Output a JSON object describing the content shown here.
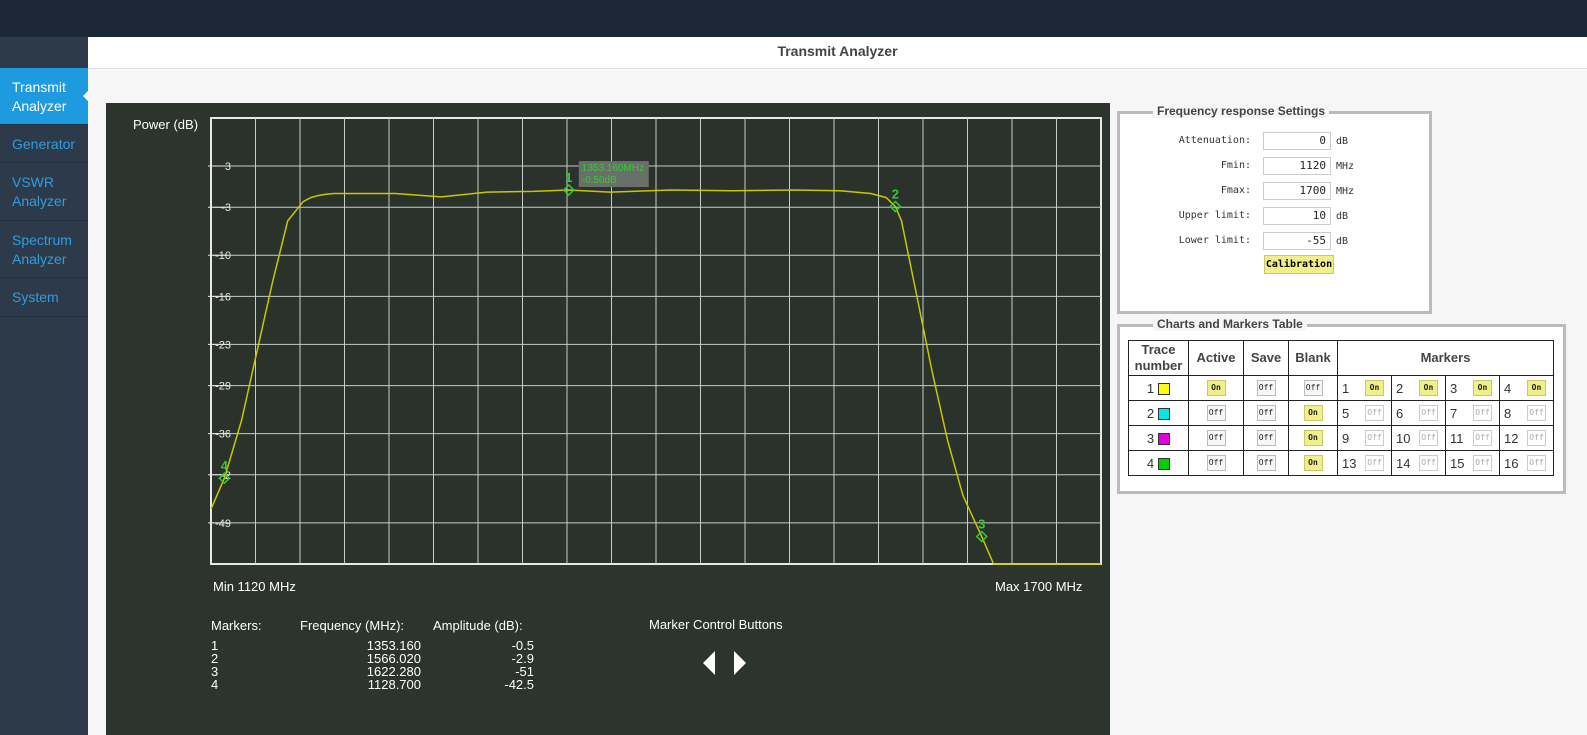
{
  "app": {
    "title": "Transmit Analyzer"
  },
  "sidebar": {
    "items": [
      {
        "label_1": "Transmit",
        "label_2": "Analyzer",
        "active": true
      },
      {
        "label_1": "Generator",
        "label_2": "",
        "active": false
      },
      {
        "label_1": "VSWR",
        "label_2": "Analyzer",
        "active": false
      },
      {
        "label_1": "Spectrum",
        "label_2": "Analyzer",
        "active": false
      },
      {
        "label_1": "System",
        "label_2": "",
        "active": false
      }
    ]
  },
  "chart": {
    "ylabel": "Power (dB)",
    "min_label": "Min 1120 MHz",
    "max_label": "Max 1700 MHz"
  },
  "chart_data": {
    "type": "line",
    "ylabel": "Power (dB)",
    "xlim": [
      1120,
      1700
    ],
    "ylim": [
      -55,
      10
    ],
    "y_ticks": [
      3,
      -3,
      -10,
      -16,
      -23,
      -29,
      -36,
      -42,
      -49
    ],
    "y_tick_labels": [
      "3",
      "-3",
      "-10",
      "-16",
      "-23",
      "-29",
      "-36",
      "-2",
      "-49"
    ],
    "grid": true,
    "series": [
      {
        "color": "#c8c800",
        "x": [
          1120,
          1128.7,
          1140,
          1150,
          1160,
          1170,
          1180,
          1185,
          1190,
          1195,
          1200,
          1210,
          1240,
          1270,
          1300,
          1330,
          1353.16,
          1380,
          1420,
          1460,
          1500,
          1530,
          1550,
          1560,
          1566.02,
          1570,
          1580,
          1590,
          1600,
          1610,
          1622.28,
          1630,
          1640,
          1700
        ],
        "y": [
          -47,
          -42.5,
          -34,
          -24,
          -14,
          -5,
          -2.2,
          -1.6,
          -1.3,
          -1.1,
          -1.0,
          -1.0,
          -1.0,
          -1.5,
          -0.8,
          -0.7,
          -0.5,
          -0.8,
          -0.5,
          -0.6,
          -0.5,
          -0.6,
          -1.0,
          -1.6,
          -2.9,
          -5,
          -16,
          -27,
          -37,
          -45,
          -51,
          -55,
          -55,
          -55
        ]
      }
    ],
    "markers": [
      {
        "id": "1",
        "x": 1353.16,
        "y": -0.5
      },
      {
        "id": "2",
        "x": 1566.02,
        "y": -2.9
      },
      {
        "id": "3",
        "x": 1622.28,
        "y": -51
      },
      {
        "id": "4",
        "x": 1128.7,
        "y": -42.5
      }
    ],
    "tooltip": {
      "freq": "1353.160MHz",
      "amp": "-0.50dB"
    }
  },
  "markers_table": {
    "col_markers": "Markers:",
    "col_frequency": "Frequency (MHz):",
    "col_amplitude": "Amplitude (dB):",
    "rows": [
      {
        "id": "1",
        "freq": "1353.160",
        "amp": "-0.5"
      },
      {
        "id": "2",
        "freq": "1566.020",
        "amp": "-2.9"
      },
      {
        "id": "3",
        "freq": "1622.280",
        "amp": "-51"
      },
      {
        "id": "4",
        "freq": "1128.700",
        "amp": "-42.5"
      }
    ]
  },
  "marker_controls": {
    "title": "Marker Control Buttons"
  },
  "freq_settings": {
    "legend": "Frequency response Settings",
    "fields": [
      {
        "label": "Attenuation:",
        "value": "0",
        "unit": "dB"
      },
      {
        "label": "Fmin:",
        "value": "1120",
        "unit": "MHz"
      },
      {
        "label": "Fmax:",
        "value": "1700",
        "unit": "MHz"
      },
      {
        "label": "Upper limit:",
        "value": "10",
        "unit": "dB"
      },
      {
        "label": "Lower limit:",
        "value": "-55",
        "unit": "dB"
      }
    ],
    "calibration": "Calibration"
  },
  "charts_markers": {
    "legend": "Charts and Markers Table",
    "headers": {
      "trace_1": "Trace",
      "trace_2": "number",
      "active": "Active",
      "save": "Save",
      "blank": "Blank",
      "markers": "Markers"
    },
    "traces": [
      {
        "num": "1",
        "color": "#ffff00",
        "active": "On",
        "save": "Off",
        "blank": "Off",
        "markers": [
          {
            "n": "1",
            "state": "On"
          },
          {
            "n": "2",
            "state": "On"
          },
          {
            "n": "3",
            "state": "On"
          },
          {
            "n": "4",
            "state": "On"
          }
        ]
      },
      {
        "num": "2",
        "color": "#00e8e8",
        "active": "Off",
        "save": "Off",
        "blank": "On",
        "markers": [
          {
            "n": "5",
            "state": "Off"
          },
          {
            "n": "6",
            "state": "Off"
          },
          {
            "n": "7",
            "state": "Off"
          },
          {
            "n": "8",
            "state": "Off"
          }
        ]
      },
      {
        "num": "3",
        "color": "#e000e0",
        "active": "Off",
        "save": "Off",
        "blank": "On",
        "markers": [
          {
            "n": "9",
            "state": "Off"
          },
          {
            "n": "10",
            "state": "Off"
          },
          {
            "n": "11",
            "state": "Off"
          },
          {
            "n": "12",
            "state": "Off"
          }
        ]
      },
      {
        "num": "4",
        "color": "#00d000",
        "active": "Off",
        "save": "Off",
        "blank": "On",
        "markers": [
          {
            "n": "13",
            "state": "Off"
          },
          {
            "n": "14",
            "state": "Off"
          },
          {
            "n": "15",
            "state": "Off"
          },
          {
            "n": "16",
            "state": "Off"
          }
        ]
      }
    ]
  },
  "colors": {
    "accent": "#1e9ae0",
    "trace": "#c8c800",
    "marker": "#33cc33",
    "button_on": "#f0ef8a"
  }
}
